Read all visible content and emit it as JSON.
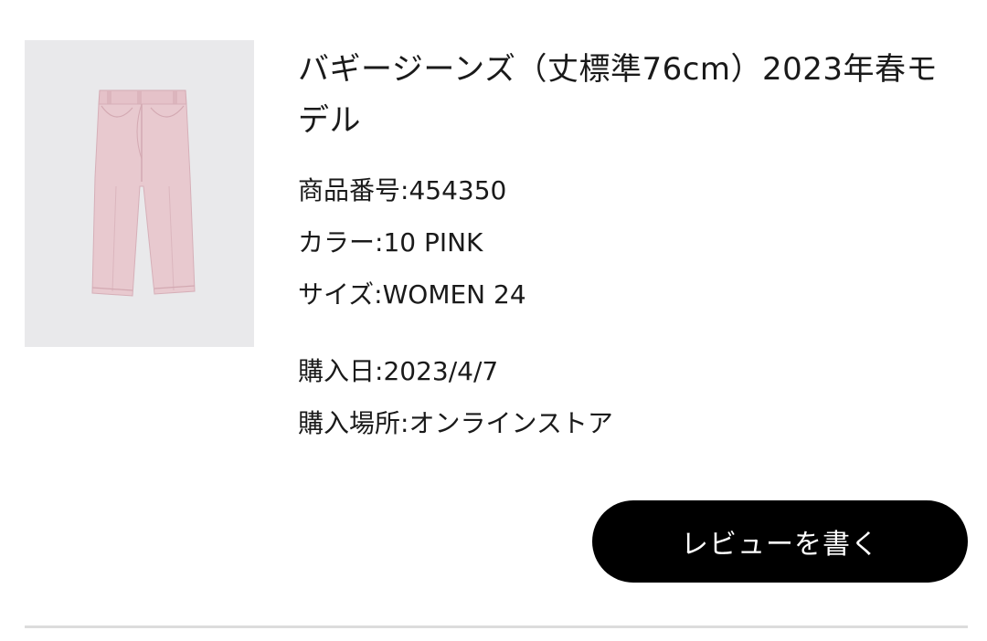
{
  "product": {
    "image_icon": "pink-baggy-jeans-image",
    "image_color": "#e8c9cf",
    "title": "バギージーンズ（丈標準76cm）2023年春モデル",
    "details": {
      "item_number_label": "商品番号: ",
      "item_number": "454350",
      "color_label": "カラー: ",
      "color": "10 PINK",
      "size_label": "サイズ: ",
      "size": "WOMEN 24"
    },
    "purchase": {
      "date_label": "購入日: ",
      "date": "2023/4/7",
      "place_label": "購入場所: ",
      "place": "オンラインストア"
    }
  },
  "actions": {
    "write_review_label": "レビューを書く"
  },
  "colors": {
    "button_bg": "#000000",
    "button_text": "#ffffff",
    "image_bg": "#e9e9eb",
    "divider": "#dcdcdc"
  }
}
